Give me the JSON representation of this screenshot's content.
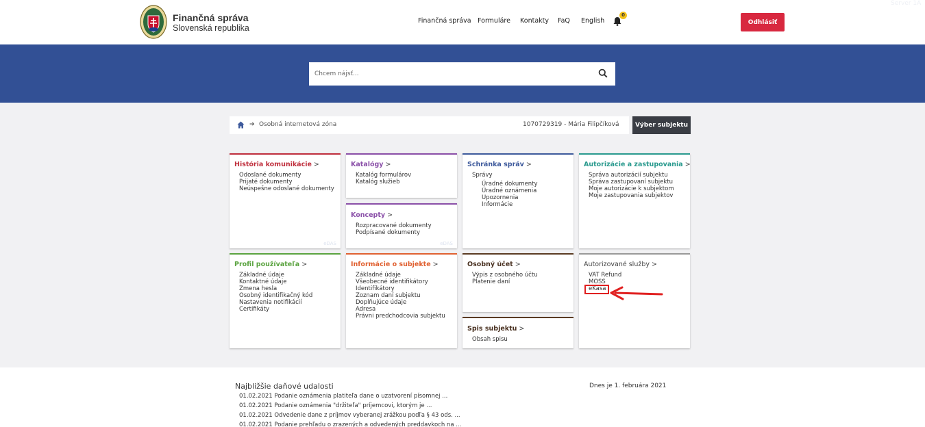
{
  "header": {
    "logo_title": "Finančná správa",
    "logo_subtitle": "Slovenská republika",
    "nav": [
      {
        "label": "Finančná správa"
      },
      {
        "label": "Formuláre"
      },
      {
        "label": "Kontakty"
      },
      {
        "label": "FaQ"
      },
      {
        "label": "English"
      }
    ],
    "notifications_count": "0",
    "logout_label": "Odhlásiť",
    "server_label": "Server 1A"
  },
  "search": {
    "placeholder": "Chcem nájsť..."
  },
  "breadcrumb": {
    "current": "Osobná internetová zóna",
    "subject": "1070729319 - Mária Filipčíková",
    "select_subject_label": "Výber subjektu"
  },
  "tiles": {
    "historia": {
      "title": "História komunikácie",
      "items": [
        "Odoslané dokumenty",
        "Prijaté dokumenty",
        "Neúspešne odoslané dokumenty"
      ],
      "watermark": "eDAS"
    },
    "katalogy": {
      "title": "Katalógy",
      "items": [
        "Katalóg formulárov",
        "Katalóg služieb"
      ]
    },
    "koncepty": {
      "title": "Koncepty",
      "items": [
        "Rozpracované dokumenty",
        "Podpísané dokumenty"
      ],
      "watermark": "eDAS"
    },
    "schranka": {
      "title": "Schránka správ",
      "group": "Správy",
      "items": [
        "Úradné dokumenty",
        "Úradné oznámenia",
        "Upozornenia",
        "Informácie"
      ]
    },
    "autorizacie": {
      "title": "Autorizácie a zastupovania",
      "items": [
        "Správa autorizácií subjektu",
        "Správa zastupovaní subjektu",
        "Moje autorizácie k subjektom",
        "Moje zastupovania subjektov"
      ]
    },
    "profil": {
      "title": "Profil používateľa",
      "items": [
        "Základné údaje",
        "Kontaktné údaje",
        "Zmena hesla",
        "Osobný identifikačný kód",
        "Nastavenia notifikácií",
        "Certifikáty"
      ]
    },
    "informacie": {
      "title": "Informácie o subjekte",
      "items": [
        "Základné údaje",
        "Všeobecné identifikátory",
        "Identifikátory",
        "Zoznam daní subjektu",
        "Doplňujúce údaje",
        "Adresa",
        "Právni predchodcovia subjektu"
      ]
    },
    "ucet": {
      "title": "Osobný účet",
      "items": [
        "Výpis z osobného účtu",
        "Platenie daní"
      ]
    },
    "spis": {
      "title": "Spis subjektu",
      "items": [
        "Obsah spisu"
      ]
    },
    "sluzby": {
      "title": "Autorizované služby",
      "items": [
        "VAT Refund",
        "MOSS",
        "eKasa"
      ]
    }
  },
  "footer": {
    "events_title": "Najbližšie daňové udalosti",
    "today": "Dnes je 1. februára 2021",
    "events": [
      "01.02.2021 Podanie oznámenia platiteľa dane o uzatvorení písomnej ...",
      "01.02.2021 Podanie oznámenia \"držiteľa\" príjemcovi, ktorým je ...",
      "01.02.2021 Odvedenie dane z príjmov vyberanej zrážkou podľa § 43 ods. ...",
      "01.02.2021 Podanie prehľadu o zrazených a odvedených preddavkoch na ..."
    ]
  },
  "colors": {
    "brand_blue": "#325095",
    "logout_red": "#d8283f",
    "highlight_red": "#e02020"
  }
}
